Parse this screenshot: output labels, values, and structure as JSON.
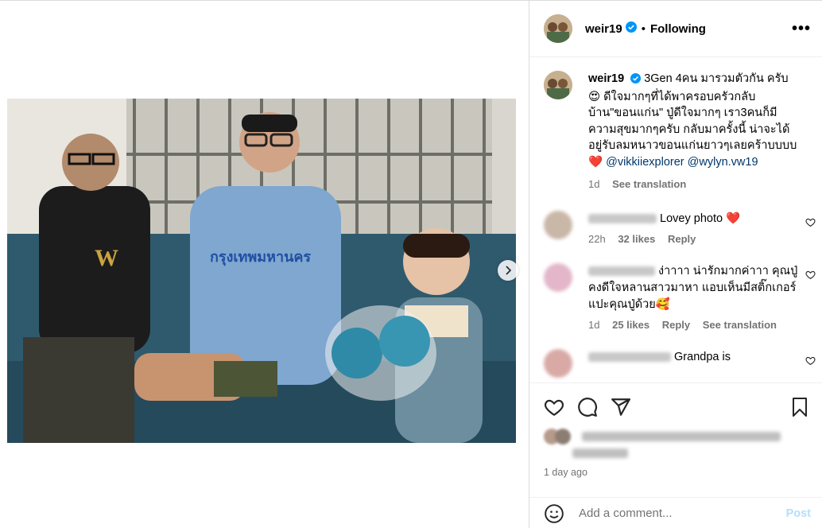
{
  "post": {
    "username": "weir19",
    "follow_status": "Following",
    "more_label": "•••",
    "caption": {
      "text_prefix": "3Gen 4คน มารวมตัวกัน ครับ 😍 ดีใจมากๆที่ได้พาครอบครัวกลับบ้าน\"ขอนแก่น\" ปู่ดีใจมากๆ เรา3คนก็มีความสุขมากๆครับ กลับมาครั้งนี้ น่าจะได้อยู่รับลมหนาวขอนแก่นยาวๆเลยคร้าบบบบ ❤️ ",
      "mention_1": "@vikkiiexplorer",
      "mention_2": "@wylyn.vw19",
      "age": "1d",
      "see_translation": "See translation"
    },
    "comments": [
      {
        "text": "Lovey photo ❤️",
        "age": "22h",
        "likes": "32 likes",
        "reply": "Reply"
      },
      {
        "text": "ง่าาาา น่ารักมากค่าาา คุณปู่คงดีใจหลานสาวมาหา แอบเห็นมีสติ๊กเกอร์แปะคุณปู่ด้วย🥰",
        "age": "1d",
        "likes": "25 likes",
        "reply": "Reply",
        "see_translation": "See translation"
      },
      {
        "text": "Grandpa is"
      }
    ],
    "time_ago": "1 day ago",
    "add_comment_placeholder": "Add a comment...",
    "post_label": "Post"
  },
  "icons": {
    "verified": "verified-badge-icon",
    "heart": "heart-icon",
    "comment": "comment-icon",
    "share": "share-icon",
    "save": "bookmark-icon",
    "emoji": "emoji-icon",
    "next": "chevron-right-icon",
    "more": "more-options-icon"
  },
  "colors": {
    "verified_blue": "#0095f6",
    "mention": "#00376b",
    "post_disabled": "#b2dffc",
    "secondary_text": "#737373"
  }
}
